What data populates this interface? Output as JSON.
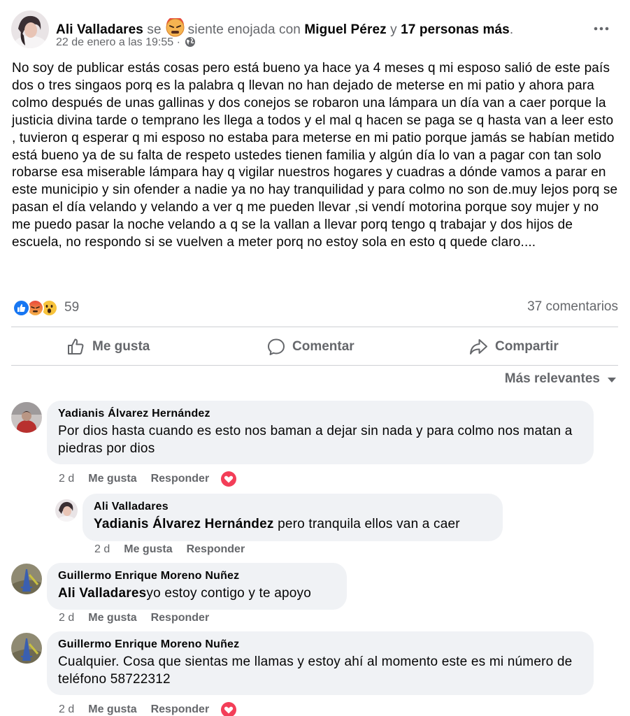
{
  "post": {
    "author": "Ali Valladares",
    "feeling_prefix": "se",
    "feeling_text": "siente enojada con",
    "tagged": "Miguel Pérez",
    "and": "y",
    "others": "17 personas más",
    "date": "22 de enero a las 19:55 ·",
    "text": "No soy de publicar estás cosas pero está bueno ya hace ya 4 meses q mi esposo salió de este país dos o tres singaos porq es la palabra q llevan no han dejado de meterse en mi patio y ahora para colmo después de unas gallinas y dos conejos se robaron una lámpara un día van a caer porque la justicia divina tarde o temprano les llega a todos y el mal q hacen se paga se q hasta van a leer esto , tuvieron q esperar q mi esposo no estaba para meterse en mi patio porque jamás se habían metido está bueno ya de su falta de respeto ustedes tienen familia y algún día lo van a pagar con tan solo robarse esa miserable lámpara hay q vigilar nuestros hogares y cuadras a dónde vamos a parar en este municipio y sin ofender a nadie ya no hay tranquilidad y para colmo no son de.muy lejos porq se pasan el día velando y velando a ver q me pueden llevar ,si vendí motorina porque soy mujer y no me puedo pasar la noche velando a q se la vallan a llevar porq tengo q trabajar y dos hijos de escuela, no respondo si se vuelven a meter porq no estoy sola en esto q quede claro....",
    "reaction_count": "59",
    "comment_count": "37 comentarios"
  },
  "actions": {
    "like": "Me gusta",
    "comment": "Comentar",
    "share": "Compartir"
  },
  "sort_label": "Más relevantes",
  "comments": [
    {
      "author": "Yadianis Álvarez Hernández",
      "text": "Por dios hasta cuando es esto nos baman a dejar sin nada y para colmo nos matan a piedras por dios",
      "time": "2 d",
      "like": "Me gusta",
      "reply": "Responder"
    },
    {
      "author": "Ali Valladares",
      "tag": "Yadianis Álvarez Hernández",
      "text": " pero tranquila ellos van a caer",
      "time": "2 d",
      "like": "Me gusta",
      "reply": "Responder"
    },
    {
      "author": "Guillermo Enrique Moreno Nuñez",
      "tag": "Ali Valladares",
      "text": "yo estoy contigo y te apoyo",
      "time": "2 d",
      "like": "Me gusta",
      "reply": "Responder"
    },
    {
      "author": "Guillermo Enrique Moreno Nuñez",
      "text": "Cualquier. Cosa que sientas me llamas y estoy ahí al momento este es mi número de teléfono 58722312",
      "time": "2 d",
      "like": "Me gusta",
      "reply": "Responder"
    }
  ],
  "colors": {
    "like_blue": "#1877f2",
    "angry_red": "#e9710f",
    "heart_red": "#f33e58",
    "muted": "#65676b",
    "bubble": "#f0f2f5"
  }
}
